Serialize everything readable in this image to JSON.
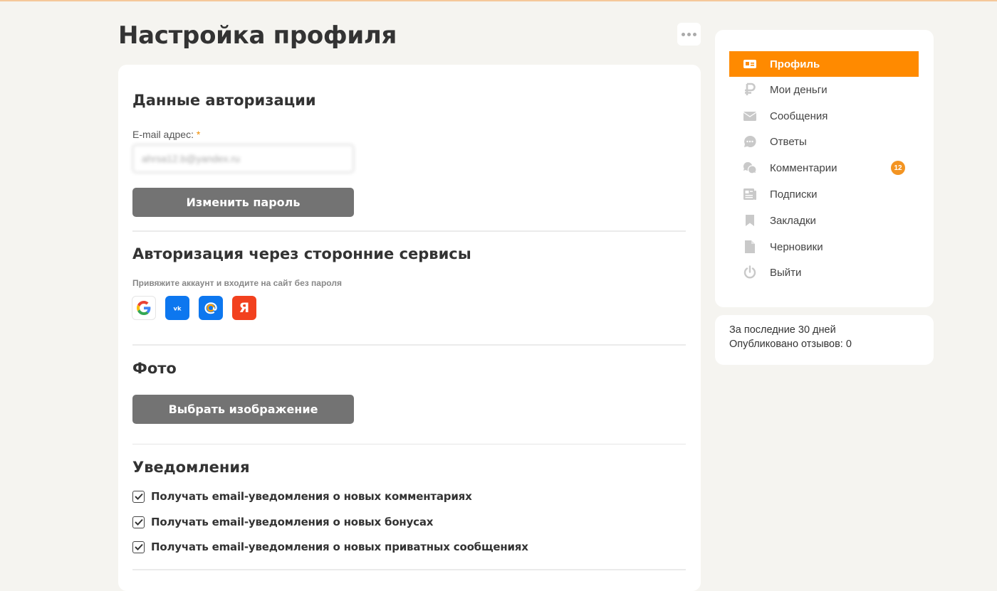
{
  "page": {
    "title": "Настройка профиля"
  },
  "auth": {
    "title": "Данные авторизации",
    "email_label": "E-mail адрес:",
    "required_mark": "*",
    "email_value": "ahrsa12.b@yandex.ru",
    "change_password_label": "Изменить пароль"
  },
  "third_party": {
    "title": "Авторизация через сторонние сервисы",
    "hint": "Привяжите аккаунт и входите на сайт без пароля",
    "providers": [
      {
        "name": "google",
        "icon": "google-icon"
      },
      {
        "name": "vk",
        "icon": "vk-icon"
      },
      {
        "name": "mail",
        "icon": "mail-ru-icon"
      },
      {
        "name": "yandex",
        "icon": "yandex-icon",
        "glyph": "Я"
      }
    ]
  },
  "photo": {
    "title": "Фото",
    "choose_label": "Выбрать изображение"
  },
  "notifications": {
    "title": "Уведомления",
    "options": [
      {
        "label": "Получать email-уведомления о новых комментариях",
        "checked": true
      },
      {
        "label": "Получать email-уведомления о новых бонусах",
        "checked": true
      },
      {
        "label": "Получать email-уведомления о новых приватных сообщениях",
        "checked": true
      }
    ]
  },
  "sidebar": {
    "items": [
      {
        "label": "Профиль",
        "icon": "profile-card-icon",
        "active": true
      },
      {
        "label": "Мои деньги",
        "icon": "ruble-icon"
      },
      {
        "label": "Сообщения",
        "icon": "envelope-icon"
      },
      {
        "label": "Ответы",
        "icon": "chat-bubble-icon"
      },
      {
        "label": "Комментарии",
        "icon": "comments-icon",
        "badge": "12"
      },
      {
        "label": "Подписки",
        "icon": "newspaper-icon"
      },
      {
        "label": "Закладки",
        "icon": "bookmark-icon"
      },
      {
        "label": "Черновики",
        "icon": "draft-file-icon"
      },
      {
        "label": "Выйти",
        "icon": "power-icon"
      }
    ]
  },
  "stats": {
    "period": "За последние 30 дней",
    "published": "Опубликовано отзывов: 0"
  },
  "colors": {
    "accent": "#ff8a00",
    "button_gray": "#737373",
    "vk_blue": "#0d77ef",
    "yandex_red": "#f2411e"
  }
}
